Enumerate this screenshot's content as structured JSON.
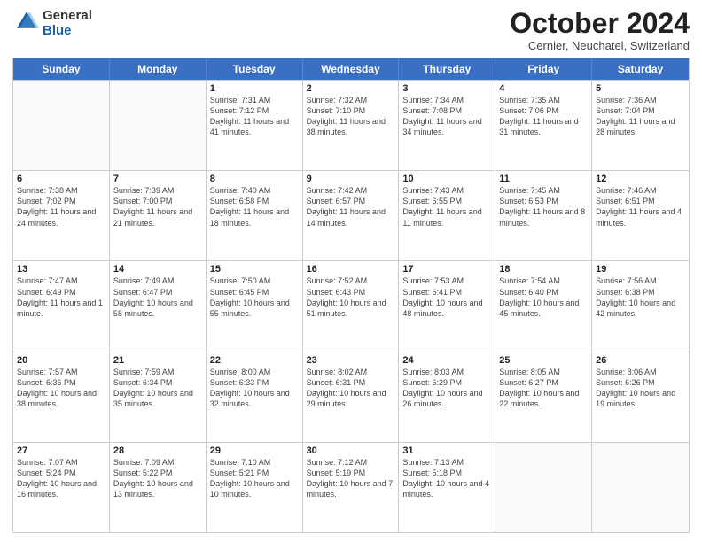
{
  "header": {
    "logo_general": "General",
    "logo_blue": "Blue",
    "month_title": "October 2024",
    "subtitle": "Cernier, Neuchatel, Switzerland"
  },
  "days_of_week": [
    "Sunday",
    "Monday",
    "Tuesday",
    "Wednesday",
    "Thursday",
    "Friday",
    "Saturday"
  ],
  "weeks": [
    [
      {
        "day": null
      },
      {
        "day": null
      },
      {
        "day": "1",
        "sunrise": "Sunrise: 7:31 AM",
        "sunset": "Sunset: 7:12 PM",
        "daylight": "Daylight: 11 hours and 41 minutes."
      },
      {
        "day": "2",
        "sunrise": "Sunrise: 7:32 AM",
        "sunset": "Sunset: 7:10 PM",
        "daylight": "Daylight: 11 hours and 38 minutes."
      },
      {
        "day": "3",
        "sunrise": "Sunrise: 7:34 AM",
        "sunset": "Sunset: 7:08 PM",
        "daylight": "Daylight: 11 hours and 34 minutes."
      },
      {
        "day": "4",
        "sunrise": "Sunrise: 7:35 AM",
        "sunset": "Sunset: 7:06 PM",
        "daylight": "Daylight: 11 hours and 31 minutes."
      },
      {
        "day": "5",
        "sunrise": "Sunrise: 7:36 AM",
        "sunset": "Sunset: 7:04 PM",
        "daylight": "Daylight: 11 hours and 28 minutes."
      }
    ],
    [
      {
        "day": "6",
        "sunrise": "Sunrise: 7:38 AM",
        "sunset": "Sunset: 7:02 PM",
        "daylight": "Daylight: 11 hours and 24 minutes."
      },
      {
        "day": "7",
        "sunrise": "Sunrise: 7:39 AM",
        "sunset": "Sunset: 7:00 PM",
        "daylight": "Daylight: 11 hours and 21 minutes."
      },
      {
        "day": "8",
        "sunrise": "Sunrise: 7:40 AM",
        "sunset": "Sunset: 6:58 PM",
        "daylight": "Daylight: 11 hours and 18 minutes."
      },
      {
        "day": "9",
        "sunrise": "Sunrise: 7:42 AM",
        "sunset": "Sunset: 6:57 PM",
        "daylight": "Daylight: 11 hours and 14 minutes."
      },
      {
        "day": "10",
        "sunrise": "Sunrise: 7:43 AM",
        "sunset": "Sunset: 6:55 PM",
        "daylight": "Daylight: 11 hours and 11 minutes."
      },
      {
        "day": "11",
        "sunrise": "Sunrise: 7:45 AM",
        "sunset": "Sunset: 6:53 PM",
        "daylight": "Daylight: 11 hours and 8 minutes."
      },
      {
        "day": "12",
        "sunrise": "Sunrise: 7:46 AM",
        "sunset": "Sunset: 6:51 PM",
        "daylight": "Daylight: 11 hours and 4 minutes."
      }
    ],
    [
      {
        "day": "13",
        "sunrise": "Sunrise: 7:47 AM",
        "sunset": "Sunset: 6:49 PM",
        "daylight": "Daylight: 11 hours and 1 minute."
      },
      {
        "day": "14",
        "sunrise": "Sunrise: 7:49 AM",
        "sunset": "Sunset: 6:47 PM",
        "daylight": "Daylight: 10 hours and 58 minutes."
      },
      {
        "day": "15",
        "sunrise": "Sunrise: 7:50 AM",
        "sunset": "Sunset: 6:45 PM",
        "daylight": "Daylight: 10 hours and 55 minutes."
      },
      {
        "day": "16",
        "sunrise": "Sunrise: 7:52 AM",
        "sunset": "Sunset: 6:43 PM",
        "daylight": "Daylight: 10 hours and 51 minutes."
      },
      {
        "day": "17",
        "sunrise": "Sunrise: 7:53 AM",
        "sunset": "Sunset: 6:41 PM",
        "daylight": "Daylight: 10 hours and 48 minutes."
      },
      {
        "day": "18",
        "sunrise": "Sunrise: 7:54 AM",
        "sunset": "Sunset: 6:40 PM",
        "daylight": "Daylight: 10 hours and 45 minutes."
      },
      {
        "day": "19",
        "sunrise": "Sunrise: 7:56 AM",
        "sunset": "Sunset: 6:38 PM",
        "daylight": "Daylight: 10 hours and 42 minutes."
      }
    ],
    [
      {
        "day": "20",
        "sunrise": "Sunrise: 7:57 AM",
        "sunset": "Sunset: 6:36 PM",
        "daylight": "Daylight: 10 hours and 38 minutes."
      },
      {
        "day": "21",
        "sunrise": "Sunrise: 7:59 AM",
        "sunset": "Sunset: 6:34 PM",
        "daylight": "Daylight: 10 hours and 35 minutes."
      },
      {
        "day": "22",
        "sunrise": "Sunrise: 8:00 AM",
        "sunset": "Sunset: 6:33 PM",
        "daylight": "Daylight: 10 hours and 32 minutes."
      },
      {
        "day": "23",
        "sunrise": "Sunrise: 8:02 AM",
        "sunset": "Sunset: 6:31 PM",
        "daylight": "Daylight: 10 hours and 29 minutes."
      },
      {
        "day": "24",
        "sunrise": "Sunrise: 8:03 AM",
        "sunset": "Sunset: 6:29 PM",
        "daylight": "Daylight: 10 hours and 26 minutes."
      },
      {
        "day": "25",
        "sunrise": "Sunrise: 8:05 AM",
        "sunset": "Sunset: 6:27 PM",
        "daylight": "Daylight: 10 hours and 22 minutes."
      },
      {
        "day": "26",
        "sunrise": "Sunrise: 8:06 AM",
        "sunset": "Sunset: 6:26 PM",
        "daylight": "Daylight: 10 hours and 19 minutes."
      }
    ],
    [
      {
        "day": "27",
        "sunrise": "Sunrise: 7:07 AM",
        "sunset": "Sunset: 5:24 PM",
        "daylight": "Daylight: 10 hours and 16 minutes."
      },
      {
        "day": "28",
        "sunrise": "Sunrise: 7:09 AM",
        "sunset": "Sunset: 5:22 PM",
        "daylight": "Daylight: 10 hours and 13 minutes."
      },
      {
        "day": "29",
        "sunrise": "Sunrise: 7:10 AM",
        "sunset": "Sunset: 5:21 PM",
        "daylight": "Daylight: 10 hours and 10 minutes."
      },
      {
        "day": "30",
        "sunrise": "Sunrise: 7:12 AM",
        "sunset": "Sunset: 5:19 PM",
        "daylight": "Daylight: 10 hours and 7 minutes."
      },
      {
        "day": "31",
        "sunrise": "Sunrise: 7:13 AM",
        "sunset": "Sunset: 5:18 PM",
        "daylight": "Daylight: 10 hours and 4 minutes."
      },
      {
        "day": null
      },
      {
        "day": null
      }
    ]
  ]
}
